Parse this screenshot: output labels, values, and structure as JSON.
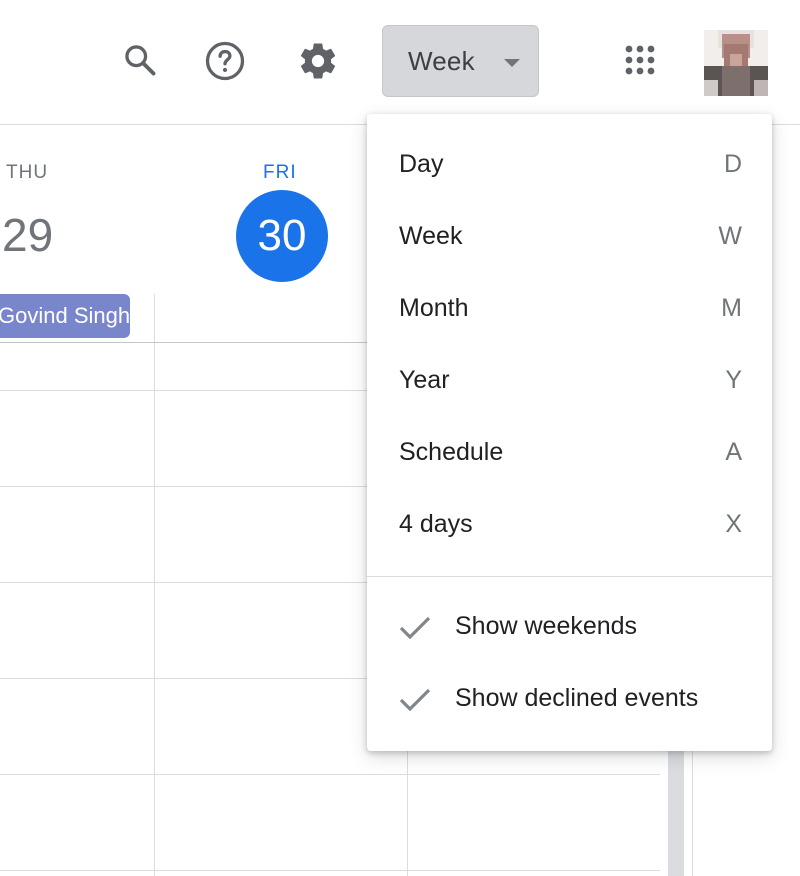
{
  "header": {
    "search_icon": "search-icon",
    "help_icon": "help-icon",
    "settings_icon": "gear-icon",
    "view_switch_label": "Week",
    "apps_icon": "apps-grid-icon"
  },
  "days": [
    {
      "dow": "THU",
      "date": "29"
    },
    {
      "dow": "FRI",
      "date": "30",
      "today": true
    }
  ],
  "events": [
    {
      "title": "Govind Singh"
    }
  ],
  "menu": {
    "items": [
      {
        "label": "Day",
        "shortcut": "D"
      },
      {
        "label": "Week",
        "shortcut": "W"
      },
      {
        "label": "Month",
        "shortcut": "M"
      },
      {
        "label": "Year",
        "shortcut": "Y"
      },
      {
        "label": "Schedule",
        "shortcut": "A"
      },
      {
        "label": "4 days",
        "shortcut": "X"
      }
    ],
    "options": [
      {
        "label": "Show weekends",
        "checked": true
      },
      {
        "label": "Show declined events",
        "checked": true
      }
    ]
  },
  "colors": {
    "accent": "#1a73e8",
    "event_chip": "#7986cb",
    "view_switch_bg": "#d5d7da",
    "grid_line": "#dadce0"
  }
}
